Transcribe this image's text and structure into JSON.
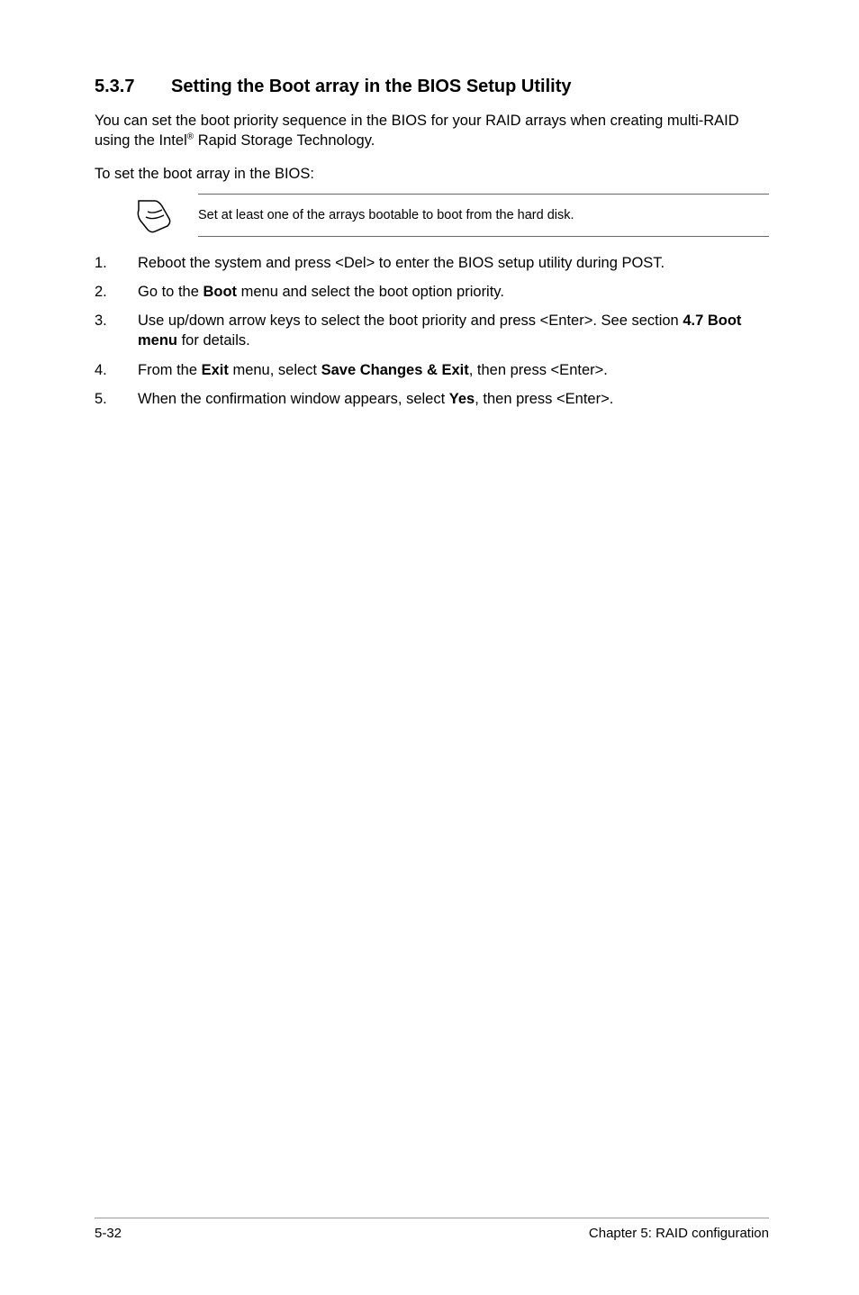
{
  "heading": {
    "number": "5.3.7",
    "title": "Setting the Boot array in the BIOS Setup Utility"
  },
  "intro": {
    "line1_before_sup": "You can set the boot priority sequence in the BIOS for your RAID arrays when creating multi-RAID using the Intel",
    "sup": "®",
    "line1_after_sup": " Rapid Storage Technology."
  },
  "para2": "To set the boot array in the BIOS:",
  "note": "Set at least one of the arrays bootable to boot from the hard disk.",
  "steps": {
    "s1": {
      "num": "1.",
      "text": "Reboot the system and press <Del> to enter the BIOS setup utility during POST."
    },
    "s2": {
      "num": "2.",
      "pre": "Go to the ",
      "bold": "Boot",
      "post": " menu and select the boot option priority."
    },
    "s3": {
      "num": "3.",
      "pre": "Use up/down arrow keys to select the boot priority and press <Enter>. See section ",
      "bold1": "4.7 Boot menu",
      "post": " for details."
    },
    "s4": {
      "num": "4.",
      "pre": "From the ",
      "bold1": "Exit",
      "mid": " menu, select ",
      "bold2": "Save Changes & Exit",
      "post": ", then press <Enter>."
    },
    "s5": {
      "num": "5.",
      "pre": "When the confirmation window appears, select ",
      "bold1": "Yes",
      "post": ", then press <Enter>."
    }
  },
  "footer": {
    "left": "5-32",
    "right": "Chapter 5: RAID configuration"
  }
}
